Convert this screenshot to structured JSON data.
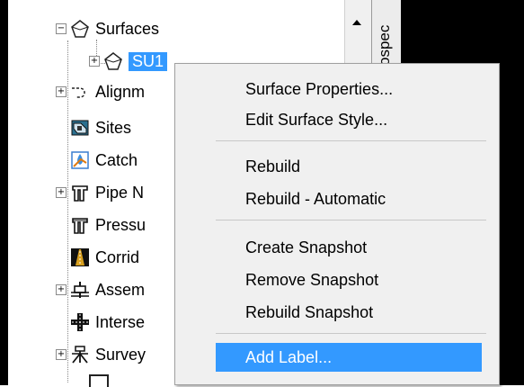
{
  "tree": {
    "items": [
      {
        "label": "Surfaces",
        "icon": "surfaces-icon",
        "expander": "−"
      },
      {
        "label": "SU1",
        "icon": "surface-icon",
        "expander": "+",
        "selected": true
      },
      {
        "label": "Alignm",
        "icon": "alignment-icon",
        "expander": "+"
      },
      {
        "label": "Sites",
        "icon": "sites-icon",
        "expander": ""
      },
      {
        "label": "Catch",
        "icon": "catchment-icon",
        "expander": ""
      },
      {
        "label": "Pipe N",
        "icon": "pipe-network-icon",
        "expander": "+"
      },
      {
        "label": "Pressu",
        "icon": "pressure-network-icon",
        "expander": ""
      },
      {
        "label": "Corrid",
        "icon": "corridor-icon",
        "expander": ""
      },
      {
        "label": "Assem",
        "icon": "assembly-icon",
        "expander": "+"
      },
      {
        "label": "Interse",
        "icon": "intersection-icon",
        "expander": ""
      },
      {
        "label": "Survey",
        "icon": "survey-icon",
        "expander": "+"
      }
    ]
  },
  "vertical_tab": {
    "label": "Prospec"
  },
  "context_menu": {
    "groups": [
      [
        "Surface Properties...",
        "Edit Surface Style..."
      ],
      [
        "Rebuild",
        "Rebuild - Automatic"
      ],
      [
        "Create Snapshot",
        "Remove Snapshot",
        "Rebuild Snapshot"
      ],
      [
        "Add Label..."
      ]
    ],
    "highlighted": "Add Label..."
  },
  "colors": {
    "selection": "#3399ff",
    "menu_bg": "#f0f0f0"
  }
}
